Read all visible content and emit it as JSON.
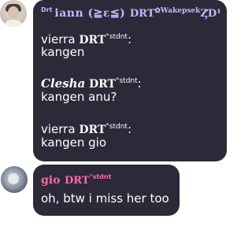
{
  "messages": [
    {
      "sender_prefix": "Drt",
      "sender_name": "iann (≧ε≦)",
      "sender_tail": "DRT",
      "sender_tail_sup": "✿Wakepsek",
      "sender_tail_end": "ȤƊ¹",
      "lines": [
        {
          "name": "vierra",
          "tag": "DRT",
          "sup": "°stdnt",
          "suffix": ":"
        },
        {
          "text": "kangen"
        },
        {
          "name": "Clesha",
          "tag": "DRT",
          "sup": "°stdnt",
          "suffix": ":"
        },
        {
          "text": "kangen anu?"
        },
        {
          "name": "vierra",
          "tag": "DRT",
          "sup": "°stdnt",
          "suffix": ":"
        },
        {
          "text": "kangen gio"
        }
      ]
    },
    {
      "sender_name": "gio",
      "sender_tag": "DRT",
      "sender_sup": "°stdnt",
      "text": "oh, btw i miss her too"
    }
  ],
  "colors": {
    "bubble": "#2b2a39",
    "sender1": "#c9b6ff",
    "sender2": "#ff6aa6",
    "text": "#ffffff"
  }
}
